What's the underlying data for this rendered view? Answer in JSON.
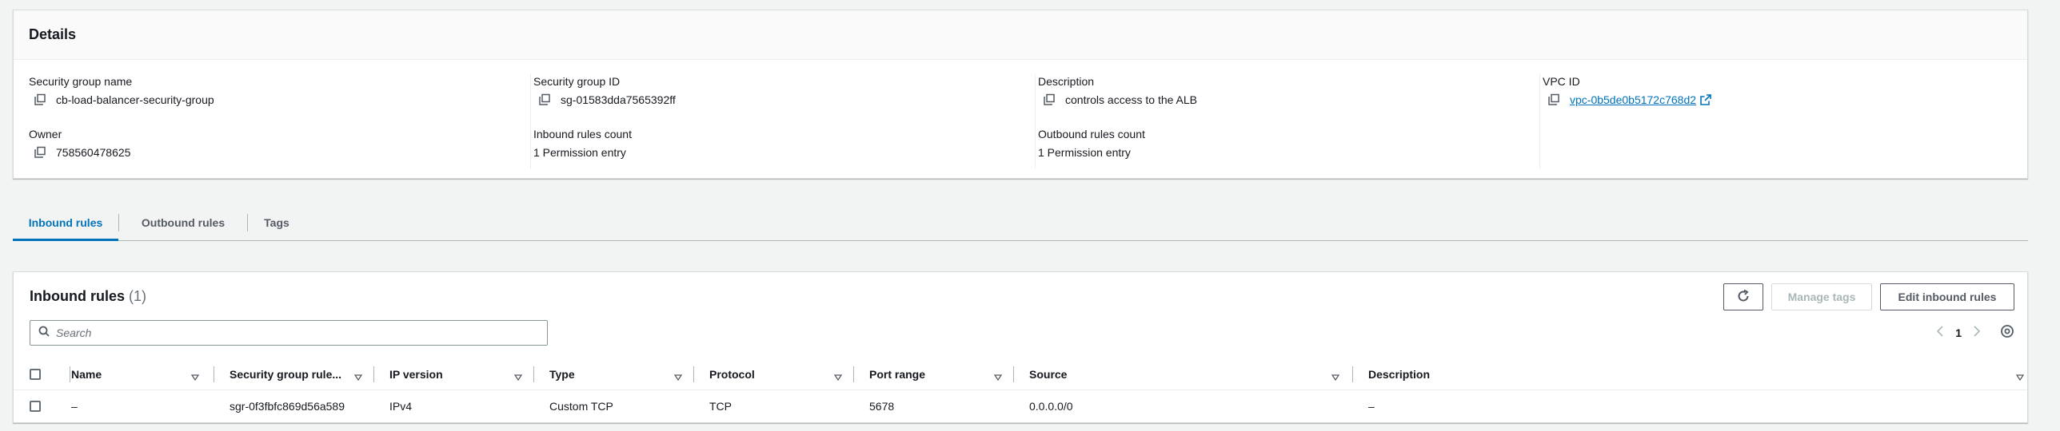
{
  "details": {
    "title": "Details",
    "fields": {
      "sg_name_label": "Security group name",
      "sg_name_value": "cb-load-balancer-security-group",
      "sg_id_label": "Security group ID",
      "sg_id_value": "sg-01583dda7565392ff",
      "description_label": "Description",
      "description_value": "controls access to the ALB",
      "vpc_id_label": "VPC ID",
      "vpc_id_value": "vpc-0b5de0b5172c768d2",
      "owner_label": "Owner",
      "owner_value": "758560478625",
      "inbound_count_label": "Inbound rules count",
      "inbound_count_value": "1 Permission entry",
      "outbound_count_label": "Outbound rules count",
      "outbound_count_value": "1 Permission entry"
    }
  },
  "tabs": [
    {
      "label": "Inbound rules",
      "active": true
    },
    {
      "label": "Outbound rules",
      "active": false
    },
    {
      "label": "Tags",
      "active": false
    }
  ],
  "rules": {
    "title": "Inbound rules",
    "count": "(1)",
    "buttons": {
      "refresh_icon": "refresh-icon",
      "manage_tags": "Manage tags",
      "edit_inbound": "Edit inbound rules"
    },
    "search_placeholder": "Search",
    "pager": {
      "page": "1"
    },
    "columns": [
      "Name",
      "Security group rule...",
      "IP version",
      "Type",
      "Protocol",
      "Port range",
      "Source",
      "Description"
    ],
    "rows": [
      {
        "name": "–",
        "rule_id": "sgr-0f3fbfc869d56a589",
        "ip_version": "IPv4",
        "type": "Custom TCP",
        "protocol": "TCP",
        "port_range": "5678",
        "source": "0.0.0.0/0",
        "description": "–"
      }
    ]
  },
  "colors": {
    "accent": "#0073bb",
    "text": "#16191f",
    "muted": "#687078",
    "border": "#d5dbdb"
  }
}
